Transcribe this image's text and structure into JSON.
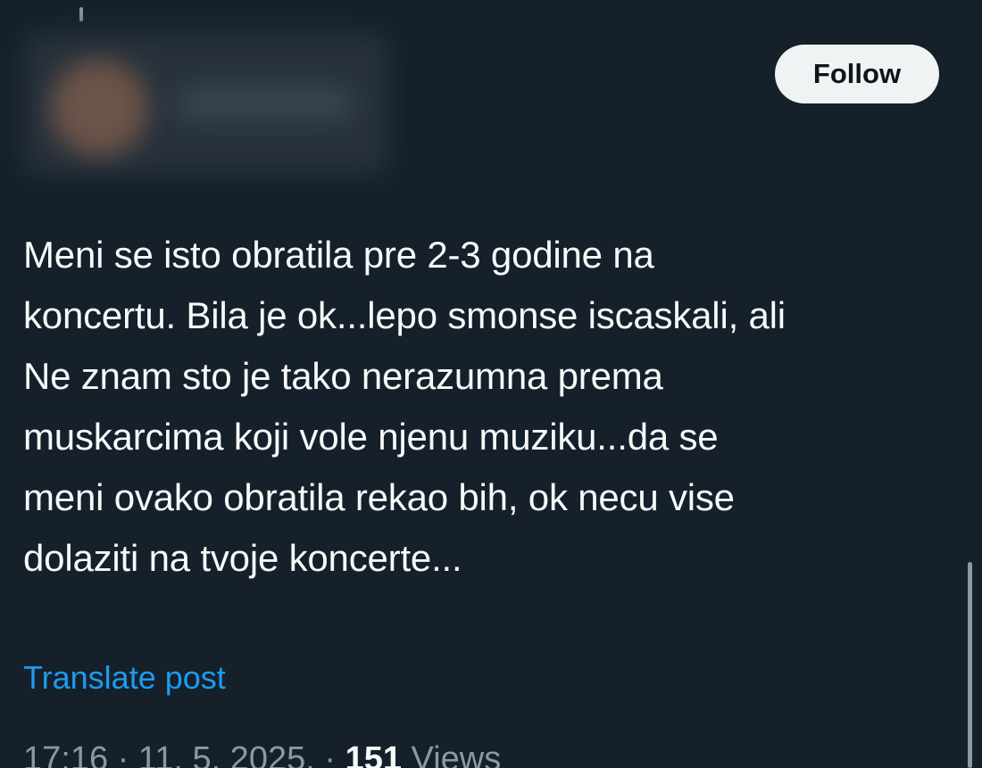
{
  "post": {
    "follow_label": "Follow",
    "text": "Meni se isto obratila pre 2-3 godine na\nkoncertu. Bila je ok...lepo smonse iscaskali, ali\nNe znam sto je tako nerazumna prema\nmuskarcima koji vole njenu muziku...da se\nmeni ovako obratila rekao bih, ok necu vise\ndolaziti na tvoje koncerte...",
    "translate_label": "Translate post",
    "time": "17:16",
    "separator": "·",
    "date": "11. 5. 2025.",
    "views_count": "151",
    "views_label": "Views"
  },
  "colors": {
    "background": "#15202b",
    "text": "#f7f9f9",
    "secondary_text": "#8b98a5",
    "link": "#1d9bf0",
    "follow_bg": "#eff3f4"
  }
}
